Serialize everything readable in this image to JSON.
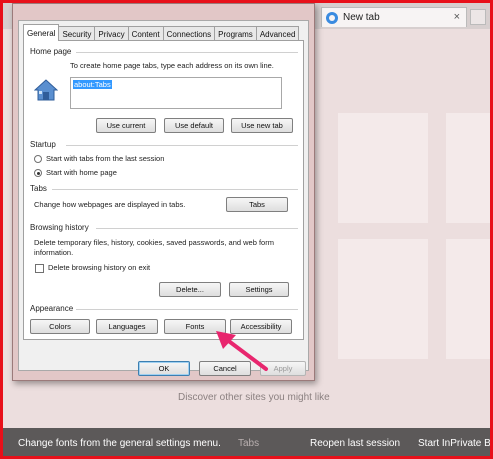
{
  "browser": {
    "tab_title": "New tab",
    "tab_close": "×",
    "discover_text": "Discover other sites you might like",
    "tabs_behind": "Tabs",
    "reopen_label": "Reopen last session",
    "inprivate_label": "Start InPrivate Browsing"
  },
  "caption": "Change fonts from the general settings menu.",
  "dialog": {
    "tabs": [
      "General",
      "Security",
      "Privacy",
      "Content",
      "Connections",
      "Programs",
      "Advanced"
    ],
    "active_tab": "General",
    "home_page": {
      "heading": "Home page",
      "instruction": "To create home page tabs, type each address on its own line.",
      "url_value": "about:Tabs",
      "buttons": {
        "use_current": "Use current",
        "use_default": "Use default",
        "use_new_tab": "Use new tab"
      }
    },
    "startup": {
      "heading": "Startup",
      "option_last_session": "Start with tabs from the last session",
      "option_home_page": "Start with home page",
      "selected": "home_page"
    },
    "tabs_section": {
      "heading": "Tabs",
      "description": "Change how webpages are displayed in tabs.",
      "button": "Tabs"
    },
    "browsing_history": {
      "heading": "Browsing history",
      "description": "Delete temporary files, history, cookies, saved passwords, and web form information.",
      "checkbox_label": "Delete browsing history on exit",
      "checkbox_checked": false,
      "delete_button": "Delete...",
      "settings_button": "Settings"
    },
    "appearance": {
      "heading": "Appearance",
      "buttons": {
        "colors": "Colors",
        "languages": "Languages",
        "fonts": "Fonts",
        "accessibility": "Accessibility"
      }
    },
    "footer": {
      "ok": "OK",
      "cancel": "Cancel",
      "apply": "Apply"
    }
  },
  "colors": {
    "frame_border": "#e8101a",
    "arrow": "#e8266e",
    "selection": "#3399ff"
  }
}
